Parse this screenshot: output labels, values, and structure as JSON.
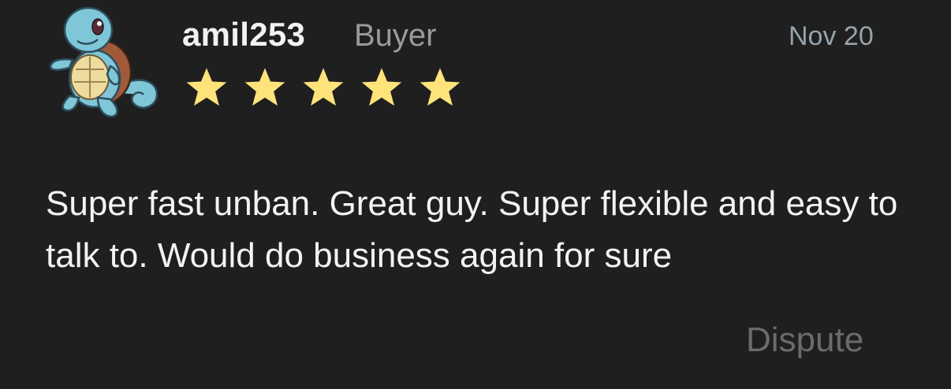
{
  "review": {
    "avatar_icon": "squirtle-avatar-icon",
    "username": "amil253",
    "role": "Buyer",
    "date": "Nov 20",
    "rating": 5,
    "rating_max": 5,
    "star_color": "#fde37a",
    "text": "Super fast unban. Great guy. Super flexible and easy to talk to. Would do business again for sure",
    "dispute_label": "Dispute"
  }
}
